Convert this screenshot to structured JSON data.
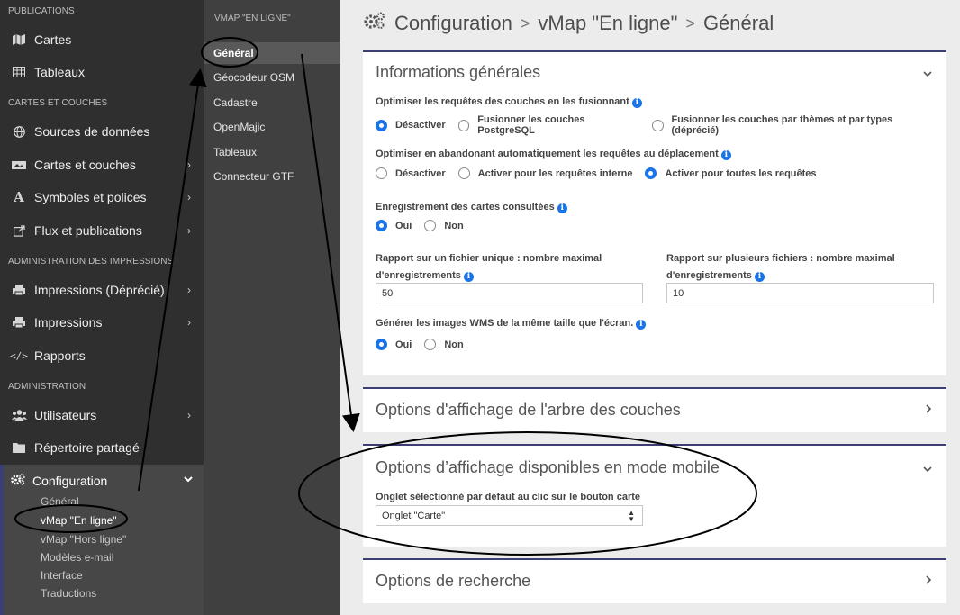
{
  "sidebar": {
    "sections": [
      {
        "label": "PUBLICATIONS"
      },
      {
        "label": "CARTES ET COUCHES"
      },
      {
        "label": "ADMINISTRATION DES IMPRESSIONS"
      },
      {
        "label": "ADMINISTRATION"
      }
    ],
    "items": [
      {
        "label": "Cartes",
        "icon": "map-icon"
      },
      {
        "label": "Tableaux",
        "icon": "table-icon"
      },
      {
        "label": "Sources de données",
        "icon": "globe-icon"
      },
      {
        "label": "Cartes et couches",
        "icon": "layers-icon"
      },
      {
        "label": "Symboles et polices",
        "icon": "font-icon"
      },
      {
        "label": "Flux et publications",
        "icon": "external-link-icon"
      },
      {
        "label": "Impressions (Déprécié)",
        "icon": "print-icon"
      },
      {
        "label": "Impressions",
        "icon": "print-icon"
      },
      {
        "label": "Rapports",
        "icon": "code-icon"
      },
      {
        "label": "Utilisateurs",
        "icon": "users-icon"
      },
      {
        "label": "Répertoire partagé",
        "icon": "folder-icon"
      }
    ],
    "config": {
      "label": "Configuration",
      "icon": "cogs-icon",
      "subitems": [
        "Général",
        "vMap \"En ligne\"",
        "vMap \"Hors ligne\"",
        "Modèles e-mail",
        "Interface",
        "Traductions"
      ]
    }
  },
  "subnav": {
    "title": "VMAP \"EN LIGNE\"",
    "items": [
      "Général",
      "Géocodeur OSM",
      "Cadastre",
      "OpenMajic",
      "Tableaux",
      "Connecteur GTF"
    ]
  },
  "breadcrumb": {
    "parts": [
      "Configuration",
      "vMap \"En ligne\"",
      "Général"
    ],
    "separator": ">"
  },
  "panels": {
    "general": {
      "title": "Informations générales",
      "q1": {
        "label": "Optimiser les requêtes des couches en les fusionnant",
        "options": [
          "Désactiver",
          "Fusionner les couches PostgreSQL",
          "Fusionner les couches par thèmes et par types (déprécié)"
        ],
        "selected": 0
      },
      "q2": {
        "label": "Optimiser en abandonant automatiquement les requêtes au déplacement",
        "options": [
          "Désactiver",
          "Activer pour les requêtes interne",
          "Activer pour toutes les requêtes"
        ],
        "selected": 2
      },
      "q3": {
        "label": "Enregistrement des cartes consultées",
        "options": [
          "Oui",
          "Non"
        ],
        "selected": 0
      },
      "report_single": {
        "label_line1": "Rapport sur un fichier unique : nombre maximal",
        "label_line2": "d'enregistrements",
        "value": "50"
      },
      "report_multi": {
        "label_line1": "Rapport sur plusieurs fichiers : nombre maximal",
        "label_line2": "d'enregistrements",
        "value": "10"
      },
      "q4": {
        "label": "Générer les images WMS de la même taille que l'écran.",
        "options": [
          "Oui",
          "Non"
        ],
        "selected": 0
      }
    },
    "tree": {
      "title": "Options d'affichage de l'arbre des couches"
    },
    "mobile": {
      "title": "Options d’affichage disponibles en mode mobile",
      "field_label": "Onglet sélectionné par défaut au clic sur le bouton carte",
      "select_value": "Onglet \"Carte\""
    },
    "search": {
      "title": "Options de recherche"
    }
  },
  "colors": {
    "sidebar_bg": "#2f2f2f",
    "subnav_bg": "#404040",
    "accent": "#1a73e8",
    "panel_border": "#3c3f73"
  }
}
